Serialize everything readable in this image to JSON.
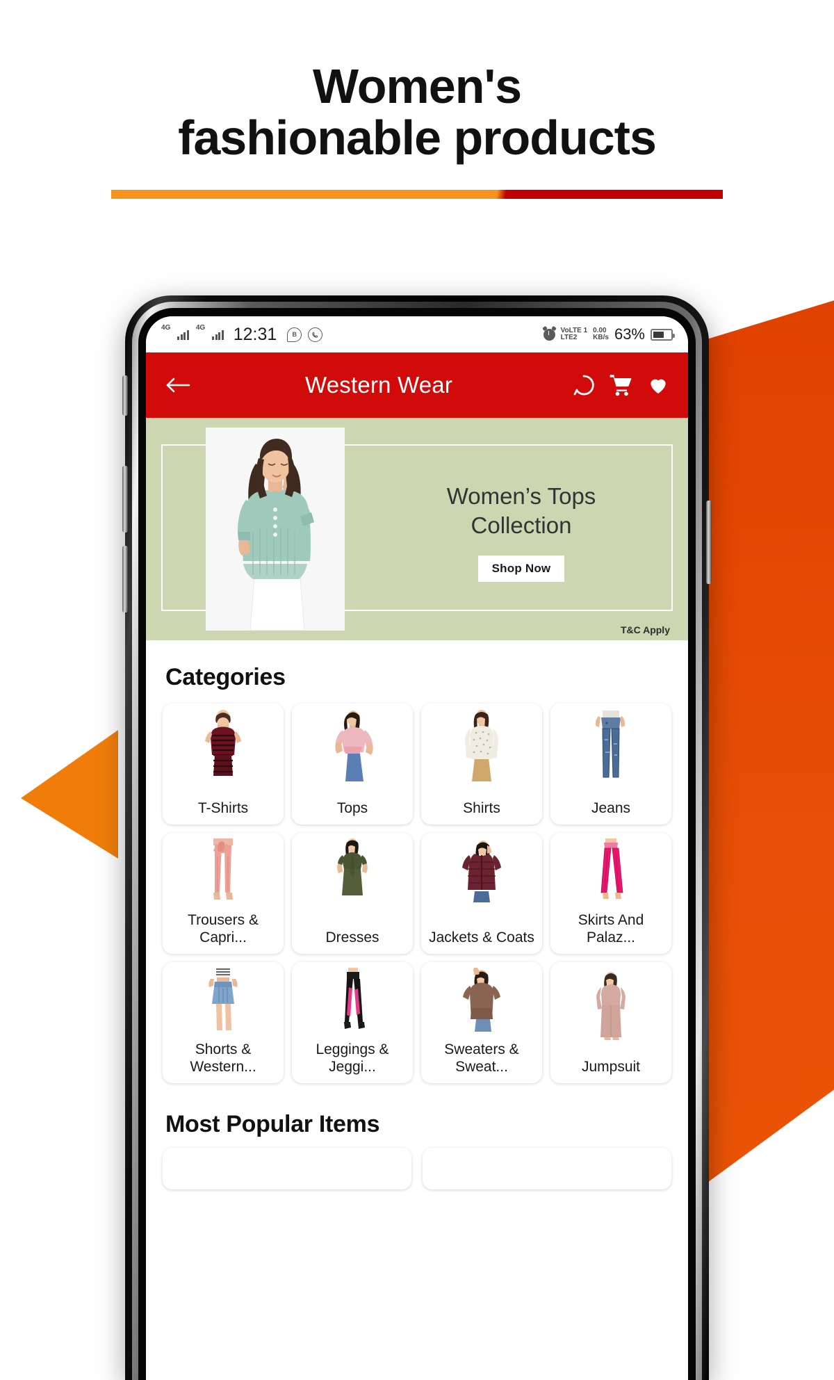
{
  "header": {
    "title_line1": "Women's",
    "title_line2": "fashionable products",
    "rule_color_left": "#f7941d",
    "rule_color_right": "#c00000"
  },
  "decor": {
    "right_shape_color": "#e84e06",
    "left_triangle_color": "#f07d09"
  },
  "phone": {
    "statusbar": {
      "network_label_1": "4G",
      "network_label_2": "4G",
      "time": "12:31",
      "icon_1": "B",
      "icon_2": "whatsapp-icon",
      "alarm": "alarm-icon",
      "volte_line1": "VoLTE 1",
      "volte_line2": "LTE2",
      "data_rate_value": "0.00",
      "data_rate_unit": "KB/s",
      "battery_percent": "63%"
    },
    "appbar": {
      "back": "back-arrow",
      "title": "Western Wear",
      "action_search": "search-icon",
      "action_cart": "cart-icon",
      "action_wishlist": "heart-icon",
      "background": "#d10a0a"
    },
    "banner": {
      "line1": "Women’s Tops",
      "line2": "Collection",
      "cta": "Shop Now",
      "terms": "T&C Apply",
      "background": "#ccd6b0"
    },
    "categories": {
      "title": "Categories",
      "items": [
        {
          "label": "T-Shirts",
          "image": "tshirt-model"
        },
        {
          "label": "Tops",
          "image": "top-model"
        },
        {
          "label": "Shirts",
          "image": "shirt-model"
        },
        {
          "label": "Jeans",
          "image": "jeans-model"
        },
        {
          "label": "Trousers & Capri...",
          "image": "trousers-model"
        },
        {
          "label": "Dresses",
          "image": "dress-model"
        },
        {
          "label": "Jackets & Coats",
          "image": "jacket-model"
        },
        {
          "label": "Skirts And Palaz...",
          "image": "palazzo-model"
        },
        {
          "label": "Shorts & Western...",
          "image": "skirt-model"
        },
        {
          "label": "Leggings & Jeggi...",
          "image": "leggings-model"
        },
        {
          "label": "Sweaters & Sweat...",
          "image": "sweater-model"
        },
        {
          "label": "Jumpsuit",
          "image": "jumpsuit-model"
        }
      ]
    },
    "popular": {
      "title": "Most Popular Items"
    }
  }
}
